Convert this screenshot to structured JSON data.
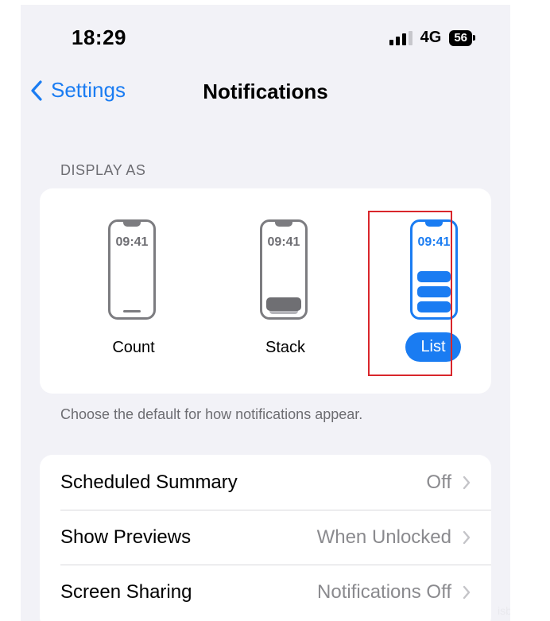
{
  "status_bar": {
    "time": "18:29",
    "network": "4G",
    "battery": "56"
  },
  "nav": {
    "back_label": "Settings",
    "title": "Notifications"
  },
  "display_as": {
    "header": "DISPLAY AS",
    "options": [
      {
        "label": "Count",
        "preview_time": "09:41",
        "selected": false
      },
      {
        "label": "Stack",
        "preview_time": "09:41",
        "selected": false
      },
      {
        "label": "List",
        "preview_time": "09:41",
        "selected": true
      }
    ],
    "footer": "Choose the default for how notifications appear."
  },
  "settings_rows": [
    {
      "label": "Scheduled Summary",
      "value": "Off"
    },
    {
      "label": "Show Previews",
      "value": "When Unlocked"
    },
    {
      "label": "Screen Sharing",
      "value": "Notifications Off"
    }
  ],
  "watermark": "isbu",
  "colors": {
    "accent": "#1a7cf2",
    "highlight": "#d9262b",
    "background": "#f2f2f7"
  },
  "icons": [
    "signal-icon",
    "battery-icon",
    "back-chevron-icon",
    "chevron-right-icon"
  ]
}
